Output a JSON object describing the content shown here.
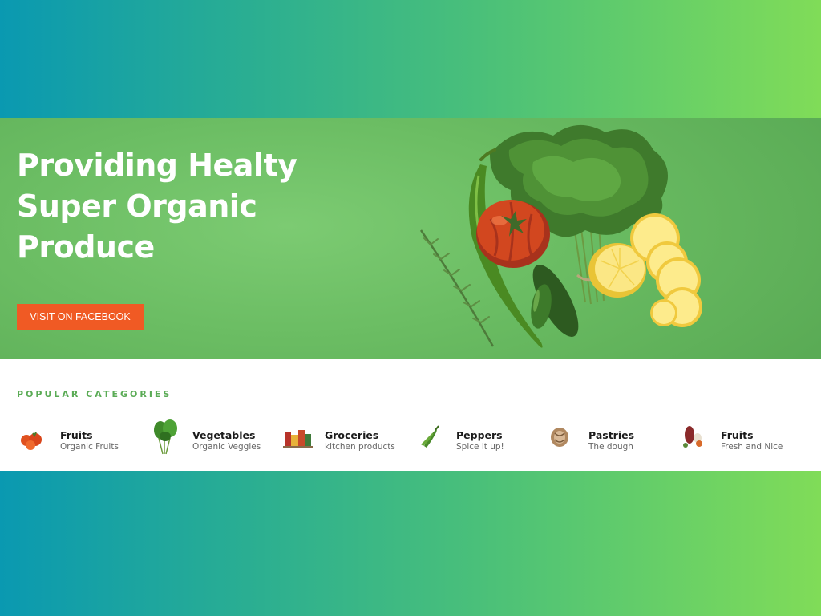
{
  "hero": {
    "title_lines": [
      "Providing Healty",
      "Super Organic",
      "Produce"
    ],
    "button_label": "VISIT ON FACEBOOK"
  },
  "categories": {
    "heading": "POPULAR CATEGORIES",
    "items": [
      {
        "name": "Fruits",
        "subtitle": "Organic Fruits",
        "icon": "tomato-icon"
      },
      {
        "name": "Vegetables",
        "subtitle": "Organic Veggies",
        "icon": "leafy-greens-icon"
      },
      {
        "name": "Groceries",
        "subtitle": "kitchen products",
        "icon": "groceries-icon"
      },
      {
        "name": "Peppers",
        "subtitle": "Spice it up!",
        "icon": "pepper-icon"
      },
      {
        "name": "Pastries",
        "subtitle": "The dough",
        "icon": "pastry-icon"
      },
      {
        "name": "Fruits",
        "subtitle": "Fresh and Nice",
        "icon": "mixed-fruits-icon"
      }
    ]
  },
  "colors": {
    "hero_green": "#6bbd63",
    "accent_orange": "#f05a24",
    "category_heading": "#5aab55",
    "gradient_start": "#0a99b1",
    "gradient_end": "#80dc58"
  }
}
